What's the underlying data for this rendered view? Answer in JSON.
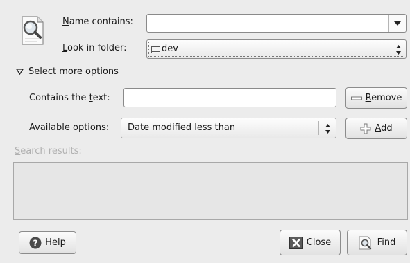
{
  "icons": {
    "search_doc": "search-document-icon",
    "folder": "folder-icon",
    "expander": "expander-down-icon",
    "remove": "remove-icon",
    "add": "add-icon",
    "help": "help-icon",
    "close": "close-icon",
    "find": "find-icon"
  },
  "name_contains": {
    "label_pre": "",
    "label_mnemonic": "N",
    "label_post": "ame contains:",
    "value": ""
  },
  "look_in_folder": {
    "label_pre": "",
    "label_mnemonic": "L",
    "label_post": "ook in folder:",
    "value": "dev"
  },
  "more_options": {
    "label_pre": "Select more ",
    "label_mnemonic": "o",
    "label_post": "ptions"
  },
  "contains_text": {
    "label_pre": "Contains the ",
    "label_mnemonic": "t",
    "label_post": "ext:",
    "value": ""
  },
  "remove_button": {
    "pre": "",
    "mnemonic": "R",
    "post": "emove"
  },
  "available_options": {
    "label_pre": "A",
    "label_mnemonic": "v",
    "label_post": "ailable options:",
    "value": "Date modified less than"
  },
  "add_button": {
    "pre": "",
    "mnemonic": "A",
    "post": "dd"
  },
  "search_results": {
    "label_pre": "",
    "label_mnemonic": "S",
    "label_post": "earch results:"
  },
  "help_button": {
    "pre": "",
    "mnemonic": "H",
    "post": "elp"
  },
  "close_button": {
    "pre": "",
    "mnemonic": "C",
    "post": "lose"
  },
  "find_button": {
    "pre": "",
    "mnemonic": "F",
    "post": "ind"
  }
}
